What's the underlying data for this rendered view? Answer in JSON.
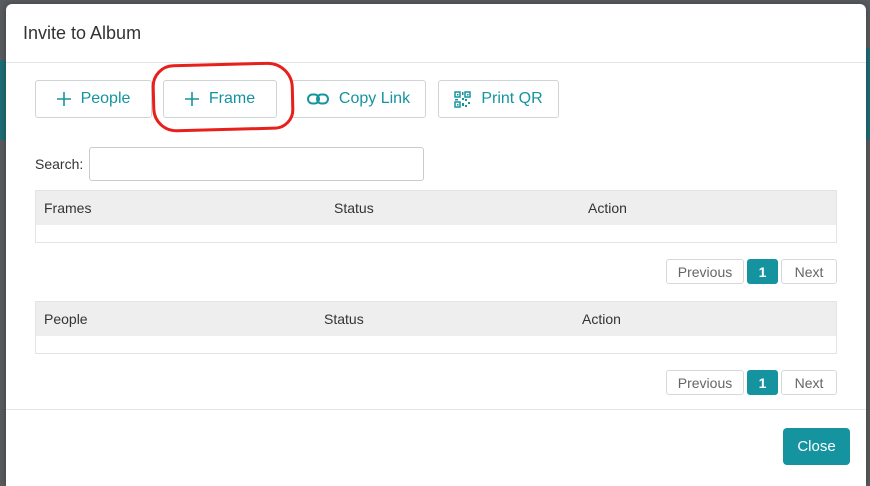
{
  "modal": {
    "title": "Invite to Album"
  },
  "toolbar": {
    "people_label": "People",
    "frame_label": "Frame",
    "copy_link_label": "Copy Link",
    "print_qr_label": "Print QR"
  },
  "search": {
    "label": "Search:",
    "value": ""
  },
  "frames_table": {
    "columns": [
      "Frames",
      "Status",
      "Action"
    ],
    "rows": []
  },
  "people_table": {
    "columns": [
      "People",
      "Status",
      "Action"
    ],
    "rows": []
  },
  "pagination": {
    "previous": "Previous",
    "current": "1",
    "next": "Next"
  },
  "footer": {
    "close_label": "Close"
  },
  "colors": {
    "accent": "#1594a0",
    "annotation": "#e8201b"
  },
  "icons": {
    "add": "plus-icon",
    "link": "link-icon",
    "qr": "qr-code-icon"
  }
}
